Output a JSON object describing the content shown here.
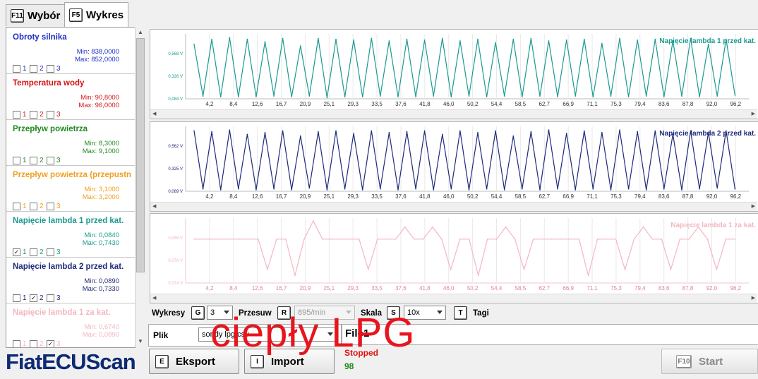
{
  "tabs": [
    {
      "key": "F11",
      "label": "Wybór"
    },
    {
      "key": "F5",
      "label": "Wykres"
    }
  ],
  "sensors": [
    {
      "name": "Obroty silnika",
      "color": "#1f2fbf",
      "min": "Min: 838,0000",
      "max": "Max: 852,0000",
      "checks": [
        false,
        false,
        false
      ]
    },
    {
      "name": "Temperatura wody",
      "color": "#d41414",
      "min": "Min: 90,8000",
      "max": "Max: 96,0000",
      "checks": [
        false,
        false,
        false
      ]
    },
    {
      "name": "Przepływ powietrza",
      "color": "#1f8a1f",
      "min": "Min: 8,3000",
      "max": "Max: 9,1000",
      "checks": [
        false,
        false,
        false
      ]
    },
    {
      "name": "Przepływ powietrza (przepustn",
      "color": "#f0a020",
      "min": "Min: 3,1000",
      "max": "Max: 3,2000",
      "checks": [
        false,
        false,
        false
      ]
    },
    {
      "name": "Napięcie lambda 1 przed kat.",
      "color": "#1a9a90",
      "min": "Min: 0,0840",
      "max": "Max: 0,7430",
      "checks": [
        true,
        false,
        false
      ]
    },
    {
      "name": "Napięcie lambda 2 przed kat.",
      "color": "#1e2a7a",
      "min": "Min: 0,0890",
      "max": "Max: 0,7330",
      "checks": [
        false,
        true,
        false
      ]
    },
    {
      "name": "Napięcie lambda 1 za kat.",
      "color": "#f4b6c2",
      "min": "Min: 0,6740",
      "max": "Max: 0,0890",
      "checks": [
        false,
        false,
        true
      ]
    }
  ],
  "check_labels": [
    "1",
    "2",
    "3"
  ],
  "x_ticks": [
    "4,2",
    "8,4",
    "12,6",
    "16,7",
    "20,9",
    "25,1",
    "29,3",
    "33,5",
    "37,6",
    "41,8",
    "46,0",
    "50,2",
    "54,4",
    "58,5",
    "62,7",
    "66,9",
    "71,1",
    "75,3",
    "79,4",
    "83,6",
    "87,8",
    "92,0",
    "96,2"
  ],
  "charts": [
    {
      "title": "Napięcie lambda 1 przed kat.",
      "color": "#1a9a90",
      "y_ticks": [
        "0,568 V",
        "0,326 V",
        "0,084 V"
      ]
    },
    {
      "title": "Napięcie lambda 2 przed kat.",
      "color": "#1e2a7a",
      "y_ticks": [
        "0,562 V",
        "0,325 V",
        "0,089 V"
      ]
    },
    {
      "title": "Napięcie lambda 1 za kat.",
      "color": "#f4b6c2",
      "y_ticks": [
        "0,088 V",
        "0,076 V",
        "0,074 V"
      ]
    }
  ],
  "chart_data": [
    {
      "type": "line",
      "title": "Napięcie lambda 1 przed kat.",
      "x_ticks": [
        "4,2",
        "8,4",
        "12,6",
        "16,7",
        "20,9",
        "25,1",
        "29,3",
        "33,5",
        "37,6",
        "41,8",
        "46,0",
        "50,2",
        "54,4",
        "58,5",
        "62,7",
        "66,9",
        "71,1",
        "75,3",
        "79,4",
        "83,6",
        "87,8",
        "92,0",
        "96,2"
      ],
      "ylim": [
        0.084,
        0.81
      ],
      "series": [
        {
          "values": [
            0.72,
            0.1,
            0.78,
            0.09,
            0.8,
            0.09,
            0.78,
            0.09,
            0.75,
            0.1,
            0.79,
            0.09,
            0.7,
            0.1,
            0.79,
            0.08,
            0.78,
            0.09,
            0.77,
            0.09,
            0.79,
            0.1,
            0.76,
            0.09,
            0.78,
            0.09,
            0.77,
            0.1,
            0.79,
            0.09,
            0.76,
            0.1,
            0.78,
            0.09,
            0.74,
            0.1,
            0.78,
            0.09,
            0.79,
            0.1,
            0.76,
            0.09,
            0.77,
            0.1,
            0.78,
            0.09,
            0.73,
            0.1,
            0.79,
            0.09,
            0.77,
            0.1,
            0.78,
            0.09,
            0.76,
            0.1,
            0.79,
            0.09,
            0.72,
            0.1,
            0.78,
            0.11
          ]
        }
      ]
    },
    {
      "type": "line",
      "title": "Napięcie lambda 2 przed kat.",
      "x_ticks": [
        "4,2",
        "8,4",
        "12,6",
        "16,7",
        "20,9",
        "25,1",
        "29,3",
        "33,5",
        "37,6",
        "41,8",
        "46,0",
        "50,2",
        "54,4",
        "58,5",
        "62,7",
        "66,9",
        "71,1",
        "75,3",
        "79,4",
        "83,6",
        "87,8",
        "92,0",
        "96,2"
      ],
      "ylim": [
        0.089,
        0.8
      ],
      "series": [
        {
          "values": [
            0.78,
            0.1,
            0.77,
            0.09,
            0.79,
            0.1,
            0.74,
            0.09,
            0.76,
            0.1,
            0.78,
            0.09,
            0.72,
            0.11,
            0.77,
            0.09,
            0.78,
            0.1,
            0.75,
            0.09,
            0.78,
            0.1,
            0.76,
            0.09,
            0.77,
            0.1,
            0.78,
            0.09,
            0.74,
            0.1,
            0.78,
            0.09,
            0.76,
            0.1,
            0.78,
            0.09,
            0.72,
            0.1,
            0.77,
            0.09,
            0.79,
            0.1,
            0.75,
            0.09,
            0.78,
            0.1,
            0.76,
            0.09,
            0.79,
            0.1,
            0.77,
            0.09,
            0.78,
            0.1,
            0.74,
            0.09,
            0.78,
            0.1,
            0.76,
            0.11,
            0.78,
            0.1
          ]
        }
      ]
    },
    {
      "type": "line",
      "title": "Napięcie lambda 1 za kat.",
      "x_ticks": [
        "4,2",
        "8,4",
        "12,6",
        "16,7",
        "20,9",
        "25,1",
        "29,3",
        "33,5",
        "37,6",
        "41,8",
        "46,0",
        "50,2",
        "54,4",
        "58,5",
        "62,7",
        "66,9",
        "71,1",
        "75,3",
        "79,4",
        "83,6",
        "87,8",
        "92,0",
        "96,2"
      ],
      "ylim": [
        0.072,
        0.092
      ],
      "series": [
        {
          "values": [
            0.086,
            0.086,
            0.086,
            0.086,
            0.086,
            0.086,
            0.086,
            0.086,
            0.076,
            0.086,
            0.086,
            0.074,
            0.086,
            0.092,
            0.086,
            0.086,
            0.086,
            0.086,
            0.086,
            0.076,
            0.086,
            0.086,
            0.086,
            0.09,
            0.086,
            0.086,
            0.09,
            0.086,
            0.076,
            0.086,
            0.086,
            0.074,
            0.086,
            0.086,
            0.09,
            0.086,
            0.076,
            0.086,
            0.086,
            0.086,
            0.086,
            0.086,
            0.086,
            0.074,
            0.086,
            0.086,
            0.086,
            0.076,
            0.086,
            0.09,
            0.086,
            0.086,
            0.076,
            0.086,
            0.086,
            0.09,
            0.086,
            0.076,
            0.086,
            0.086
          ]
        }
      ]
    }
  ],
  "controls": {
    "wykresy_label": "Wykresy",
    "wykresy_key": "G",
    "wykresy_value": "3",
    "przesuw_label": "Przesuw",
    "przesuw_key": "R",
    "przesuw_value": "895/min",
    "skala_label": "Skala",
    "skala_key": "S",
    "skala_value": "10x",
    "tagi_key": "T",
    "tagi_label": "Tagi"
  },
  "file": {
    "label": "Plik",
    "value": "sondy lpg.csv",
    "name": "File1",
    "status": "Stopped",
    "count": "98"
  },
  "buttons": {
    "export_key": "E",
    "export": "Eksport",
    "import_key": "I",
    "import": "Import",
    "start_key": "F10",
    "start": "Start"
  },
  "logo": "FiatECUScan",
  "overlay": "ciepły LPG"
}
